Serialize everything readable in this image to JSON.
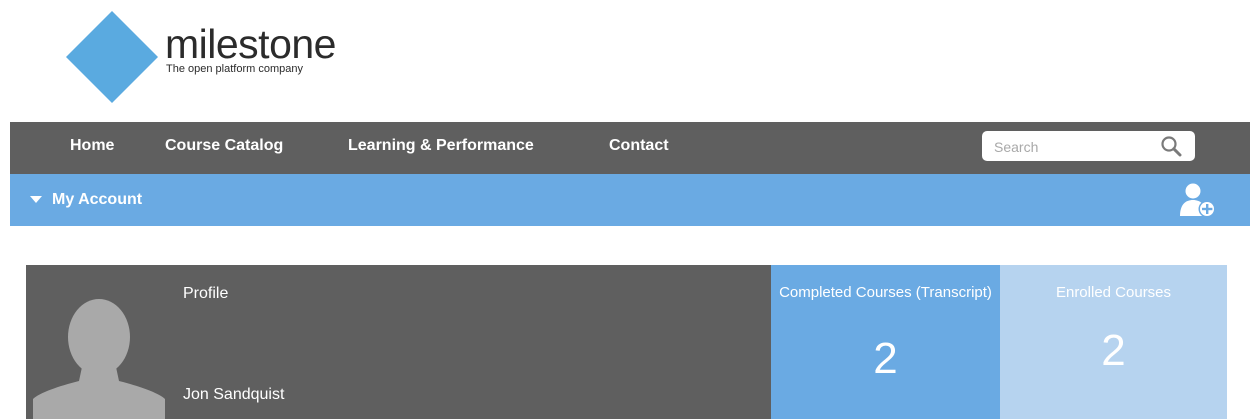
{
  "brand": {
    "name": "milestone",
    "tagline": "The open platform company",
    "color": "#5aaae0"
  },
  "nav": {
    "items": [
      {
        "label": "Home"
      },
      {
        "label": "Course Catalog"
      },
      {
        "label": "Learning & Performance"
      },
      {
        "label": "Contact"
      }
    ],
    "search_placeholder": "Search",
    "search_icon": "search-icon",
    "background": "#5f5f5f"
  },
  "account_bar": {
    "label": "My Account",
    "toggle_icon": "caret-down-icon",
    "action_icon": "add-user-icon",
    "background": "#6aaae3"
  },
  "profile": {
    "title": "Profile",
    "name": "Jon Sandquist",
    "avatar_icon": "user-silhouette-icon"
  },
  "stats": {
    "completed": {
      "label": "Completed Courses (Transcript)",
      "count": "2",
      "color": "#6aaae3"
    },
    "enrolled": {
      "label": "Enrolled Courses",
      "count": "2",
      "color": "#b6d3ef"
    }
  }
}
